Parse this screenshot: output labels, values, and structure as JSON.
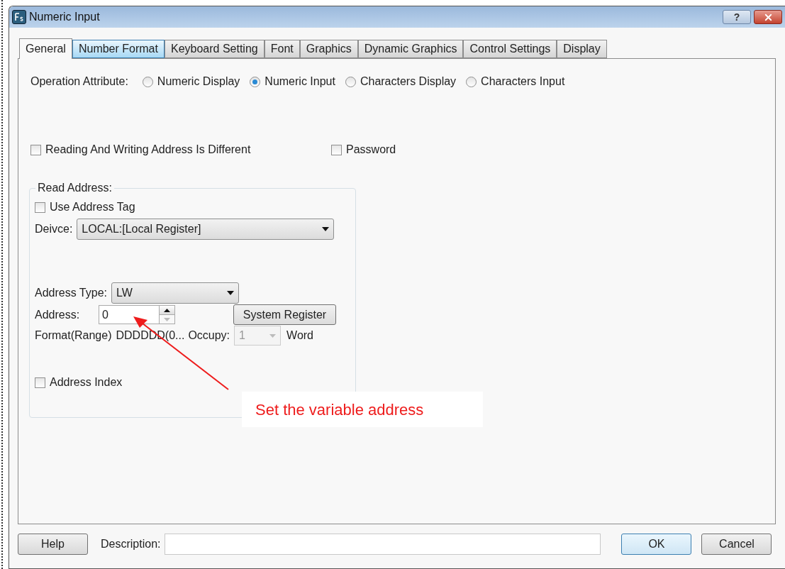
{
  "window": {
    "title": "Numeric Input",
    "help_glyph": "?"
  },
  "tabs": [
    {
      "label": "General",
      "selected": true,
      "hovered": false
    },
    {
      "label": "Number Format",
      "selected": false,
      "hovered": true
    },
    {
      "label": "Keyboard Setting",
      "selected": false,
      "hovered": false
    },
    {
      "label": "Font",
      "selected": false,
      "hovered": false
    },
    {
      "label": "Graphics",
      "selected": false,
      "hovered": false
    },
    {
      "label": "Dynamic Graphics",
      "selected": false,
      "hovered": false
    },
    {
      "label": "Control Settings",
      "selected": false,
      "hovered": false
    },
    {
      "label": "Display",
      "selected": false,
      "hovered": false
    }
  ],
  "operation_attribute": {
    "label": "Operation Attribute:",
    "options": [
      {
        "label": "Numeric Display",
        "selected": false
      },
      {
        "label": "Numeric Input",
        "selected": true
      },
      {
        "label": "Characters Display",
        "selected": false
      },
      {
        "label": "Characters Input",
        "selected": false
      }
    ]
  },
  "options": [
    {
      "label": "Reading And Writing Address Is Different",
      "checked": false
    },
    {
      "label": "Password",
      "checked": false
    }
  ],
  "read_address": {
    "title": "Read Address:",
    "use_address_tag": {
      "label": "Use Address Tag",
      "checked": false
    },
    "device": {
      "label": "Deivce:",
      "value": "LOCAL:[Local Register]"
    },
    "address_type": {
      "label": "Address Type:",
      "value": "LW"
    },
    "address": {
      "label": "Address:",
      "value": "0"
    },
    "system_register_button": "System Register",
    "format": {
      "label": "Format(Range)",
      "value": "DDDDDD(0..."
    },
    "occupy": {
      "label": "Occupy:",
      "value": "1",
      "disabled": true,
      "unit": "Word"
    },
    "address_index": {
      "label": "Address Index",
      "checked": false
    }
  },
  "annotation": {
    "text": "Set the variable address"
  },
  "footer": {
    "help": "Help",
    "description_label": "Description:",
    "ok": "OK",
    "cancel": "Cancel"
  }
}
